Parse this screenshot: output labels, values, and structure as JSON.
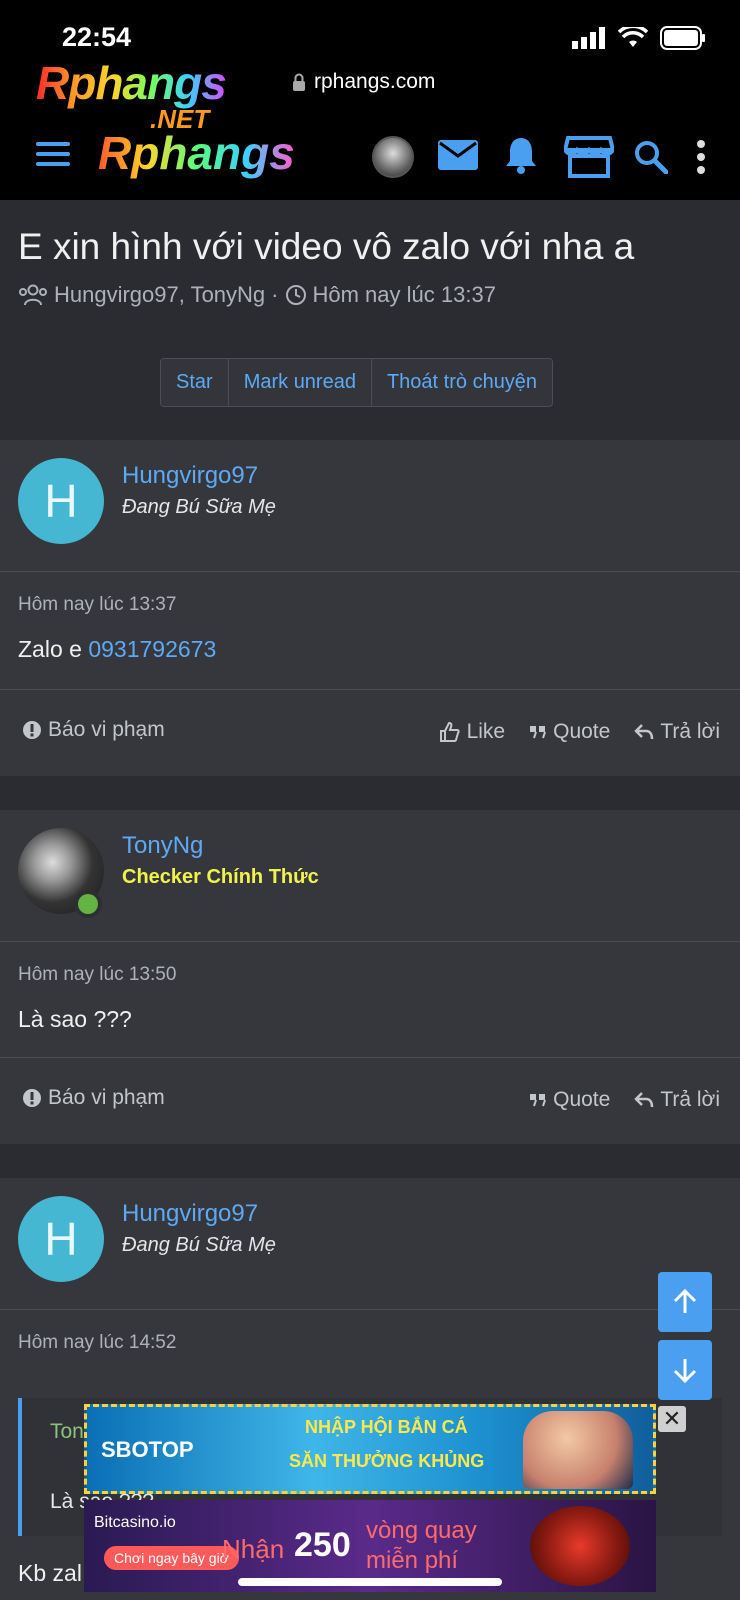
{
  "status_bar": {
    "time": "22:54"
  },
  "browser": {
    "url": "rphangs.com"
  },
  "logo": {
    "small": "Rphangs",
    "net": ".NET",
    "big": "Rphangs"
  },
  "conversation": {
    "title": "E xin hình với video vô zalo với nha a",
    "participants": "Hungvirgo97, TonyNg",
    "separator": "·",
    "time": "Hôm nay lúc 13:37",
    "buttons": {
      "star": "Star",
      "mark_unread": "Mark unread",
      "leave": "Thoát trò chuyện"
    }
  },
  "messages": [
    {
      "avatar_letter": "H",
      "username": "Hungvirgo97",
      "user_title": "Đang Bú Sữa Mẹ",
      "date": "Hôm nay lúc 13:37",
      "text_prefix": "Zalo e ",
      "text_link": "0931792673",
      "report": "Báo vi phạm",
      "like": "Like",
      "quote": "Quote",
      "reply": "Trả lời"
    },
    {
      "username": "TonyNg",
      "user_title": "Checker Chính Thức",
      "date": "Hôm nay lúc 13:50",
      "text": "Là sao ???",
      "report": "Báo vi phạm",
      "quote": "Quote",
      "reply": "Trả lời"
    },
    {
      "avatar_letter": "H",
      "username": "Hungvirgo97",
      "user_title": "Đang Bú Sữa Mẹ",
      "date": "Hôm nay lúc 14:52",
      "quote_user": "Ton",
      "quote_text": "Là sao ???",
      "text": "Kb zal"
    }
  ],
  "ads": {
    "ad1": {
      "brand": "SBOTOP",
      "line1": "NHẬP HỘI BẮN CÁ",
      "line2": "SĂN THƯỞNG KHỦNG"
    },
    "ad2": {
      "brand": "Bitcasino.io",
      "cta": "Chơi ngay bây giờ",
      "prefix": "Nhận",
      "number": "250",
      "line1": "vòng quay",
      "line2": "miễn phí"
    }
  },
  "colors": {
    "accent": "#5ea9f4",
    "background": "#2b2c31",
    "panel": "#35373c",
    "checker": "#f2f24e"
  }
}
